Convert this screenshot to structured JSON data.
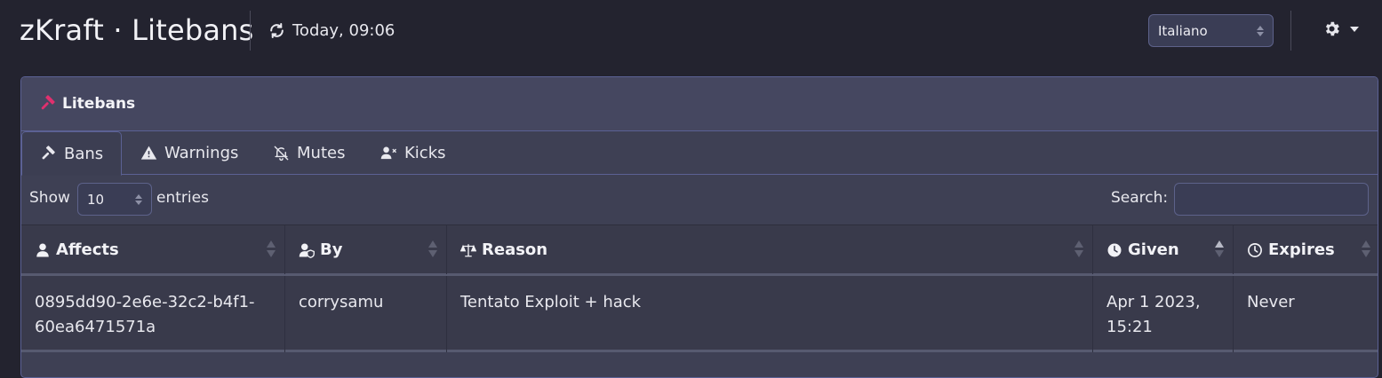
{
  "header": {
    "title": "zKraft · Litebans",
    "updated": "Today, 09:06",
    "language": "Italiano"
  },
  "card": {
    "title": "Litebans",
    "tabs": [
      {
        "label": "Bans",
        "active": true,
        "icon": "gavel-icon"
      },
      {
        "label": "Warnings",
        "active": false,
        "icon": "warning-icon"
      },
      {
        "label": "Mutes",
        "active": false,
        "icon": "bell-slash-icon"
      },
      {
        "label": "Kicks",
        "active": false,
        "icon": "user-x-icon"
      }
    ]
  },
  "controls": {
    "show_label": "Show",
    "length": "10",
    "entries_label": "entries",
    "search_label": "Search:",
    "search_value": ""
  },
  "table": {
    "columns": [
      {
        "label": "Affects",
        "icon": "user-icon"
      },
      {
        "label": "By",
        "icon": "user-shield-icon"
      },
      {
        "label": "Reason",
        "icon": "scale-icon"
      },
      {
        "label": "Given",
        "icon": "clock-icon",
        "sorted": "asc"
      },
      {
        "label": "Expires",
        "icon": "clock-outline-icon"
      }
    ],
    "rows": [
      {
        "affects_line1": "0895dd90-2e6e-32c2-b4f1-",
        "affects_line2": "60ea6471571a",
        "by": "corrysamu",
        "reason": "Tentato Exploit + hack",
        "given_line1": "Apr 1 2023,",
        "given_line2": "15:21",
        "expires": "Never"
      }
    ]
  },
  "colors": {
    "background": "#23232f",
    "card": "#3e4054",
    "accent_pink": "#e0306e",
    "border": "#5b6194"
  }
}
